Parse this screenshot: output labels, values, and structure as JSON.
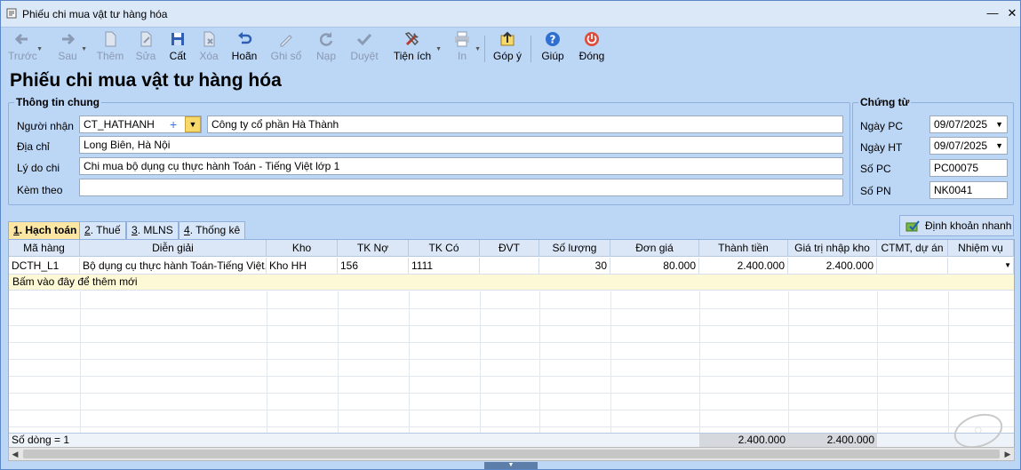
{
  "window": {
    "title": "Phiếu chi mua vật tư hàng hóa"
  },
  "toolbar": {
    "prev": "Trước",
    "next": "Sau",
    "add": "Thêm",
    "edit": "Sửa",
    "save": "Cất",
    "delete": "Xóa",
    "undo": "Hoãn",
    "post": "Ghi sổ",
    "load": "Nạp",
    "approve": "Duyệt",
    "utilities": "Tiện ích",
    "print": "In",
    "feedback": "Góp ý",
    "help": "Giúp",
    "close": "Đóng"
  },
  "page": {
    "title": "Phiếu chi mua vật tư hàng hóa"
  },
  "general": {
    "title": "Thông tin chung",
    "recipient_label": "Người nhận",
    "recipient_code": "CT_HATHANH",
    "recipient_name": "Công ty cổ phần Hà Thành",
    "address_label": "Địa chỉ",
    "address": "Long Biên, Hà Nội",
    "reason_label": "Lý do chi",
    "reason": "Chi mua bộ dụng cụ thực hành Toán - Tiếng Việt lớp 1",
    "attach_label": "Kèm theo",
    "attach": ""
  },
  "voucher": {
    "title": "Chứng từ",
    "date_pc_label": "Ngày PC",
    "date_pc": "09/07/2025",
    "date_ht_label": "Ngày HT",
    "date_ht": "09/07/2025",
    "so_pc_label": "Số PC",
    "so_pc": "PC00075",
    "so_pn_label": "Số PN",
    "so_pn": "NK0041"
  },
  "tabs": [
    {
      "num": "1",
      "label": ". Hạch toán"
    },
    {
      "num": "2",
      "label": ". Thuế"
    },
    {
      "num": "3",
      "label": ". MLNS"
    },
    {
      "num": "4",
      "label": ". Thống kê"
    }
  ],
  "quick_button": "Định khoản nhanh",
  "grid": {
    "columns": [
      "Mã hàng",
      "Diễn giải",
      "Kho",
      "TK Nợ",
      "TK Có",
      "ĐVT",
      "Số lượng",
      "Đơn giá",
      "Thành tiền",
      "Giá trị nhập kho",
      "CTMT, dự án",
      "Nhiệm vụ"
    ],
    "rows": [
      {
        "ma_hang": "DCTH_L1",
        "dien_giai": "Bộ dụng cụ thực hành Toán-Tiếng Việt...",
        "kho": "Kho HH",
        "tk_no": "156",
        "tk_co": "1111",
        "dvt": "",
        "so_luong": "30",
        "don_gia": "80.000",
        "thanh_tien": "2.400.000",
        "gia_tri_nhap_kho": "2.400.000",
        "ctmt": "",
        "nhiem_vu": ""
      }
    ],
    "new_row_hint": "Bấm vào đây để thêm mới",
    "footer": {
      "row_count": "Số dòng = 1",
      "total_thanh_tien": "2.400.000",
      "total_gia_tri": "2.400.000"
    }
  }
}
